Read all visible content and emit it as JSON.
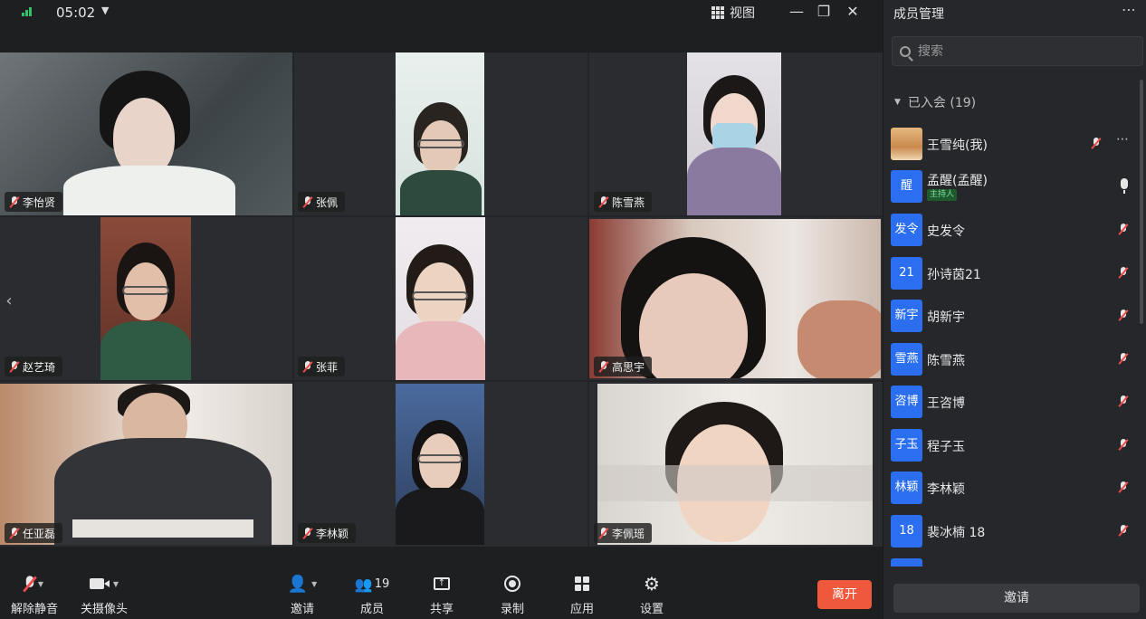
{
  "topbar": {
    "time": "05:02",
    "view_label": "视图",
    "icons": [
      "signal-icon",
      "chevron-down-icon",
      "grid-icon",
      "minimize-icon",
      "restore-icon",
      "close-icon"
    ]
  },
  "grid": {
    "tiles": [
      {
        "name": "李怡贤",
        "muted": true
      },
      {
        "name": "张佩",
        "muted": true
      },
      {
        "name": "陈雪燕",
        "muted": true
      },
      {
        "name": "赵艺琦",
        "muted": true
      },
      {
        "name": "张菲",
        "muted": true
      },
      {
        "name": "高思宇",
        "muted": true
      },
      {
        "name": "任亚磊",
        "muted": true
      },
      {
        "name": "李林颖",
        "muted": true
      },
      {
        "name": "李佩瑶",
        "muted": true
      }
    ]
  },
  "toolbar": {
    "unmute_label": "解除静音",
    "camera_label": "关摄像头",
    "invite_label": "邀请",
    "members_label": "成员",
    "members_count": "19",
    "share_label": "共享",
    "record_label": "录制",
    "apps_label": "应用",
    "settings_label": "设置",
    "leave_label": "离开"
  },
  "panel": {
    "title": "成员管理",
    "search_placeholder": "搜索",
    "group_label": "已入会 (19)",
    "invite_label": "邀请",
    "host_badge": "主持人",
    "members": [
      {
        "avatar": "",
        "name": "王雪纯(我)",
        "mic": "muted",
        "more": true
      },
      {
        "avatar": "醒",
        "name": "孟醒(孟醒)",
        "mic": "on",
        "host": true
      },
      {
        "avatar": "发令",
        "name": "史发令",
        "mic": "muted"
      },
      {
        "avatar": "21",
        "name": "孙诗茵21",
        "mic": "muted"
      },
      {
        "avatar": "新宇",
        "name": "胡新宇",
        "mic": "muted"
      },
      {
        "avatar": "雪燕",
        "name": "陈雪燕",
        "mic": "muted"
      },
      {
        "avatar": "咨博",
        "name": "王咨博",
        "mic": "muted"
      },
      {
        "avatar": "子玉",
        "name": "程子玉",
        "mic": "muted"
      },
      {
        "avatar": "林颖",
        "name": "李林颖",
        "mic": "muted"
      },
      {
        "avatar": "18",
        "name": "裴冰楠  18",
        "mic": "muted"
      }
    ]
  }
}
